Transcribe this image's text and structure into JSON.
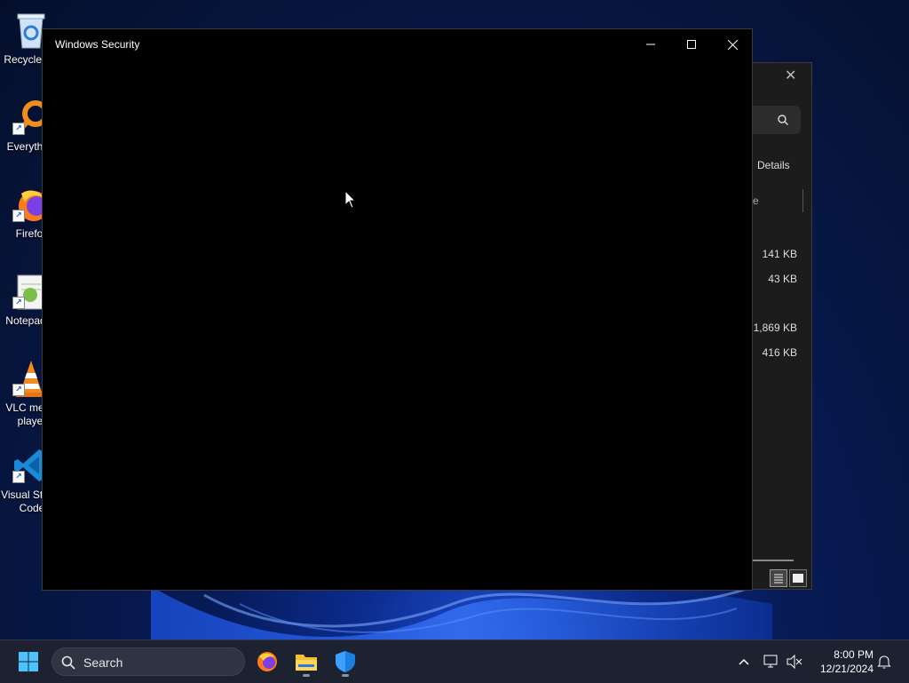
{
  "desktop": {
    "icons": [
      {
        "label": "Recycle Bin",
        "icon": "recycle-bin-icon"
      },
      {
        "label": "Everything",
        "icon": "everything-search-icon"
      },
      {
        "label": "Firefox",
        "icon": "firefox-icon"
      },
      {
        "label": "Notepad++",
        "icon": "notepad-plus-plus-icon"
      },
      {
        "label": "VLC media player",
        "icon": "vlc-icon"
      },
      {
        "label": "Visual Studio Code",
        "icon": "vscode-icon"
      }
    ]
  },
  "background_window": {
    "details_label": "Details",
    "header_fragment": "e",
    "sizes": [
      "141 KB",
      "43 KB",
      "1,869 KB",
      "416 KB"
    ]
  },
  "main_window": {
    "title": "Windows Security"
  },
  "taskbar": {
    "search_label": "Search",
    "apps": [
      "firefox-icon",
      "file-explorer-icon",
      "windows-security-icon"
    ],
    "clock": {
      "time": "8:00 PM",
      "date": "12/21/2024"
    }
  },
  "colors": {
    "taskbar": "#1c2230",
    "window_bg": "#000000",
    "accent": "#0078d4"
  }
}
